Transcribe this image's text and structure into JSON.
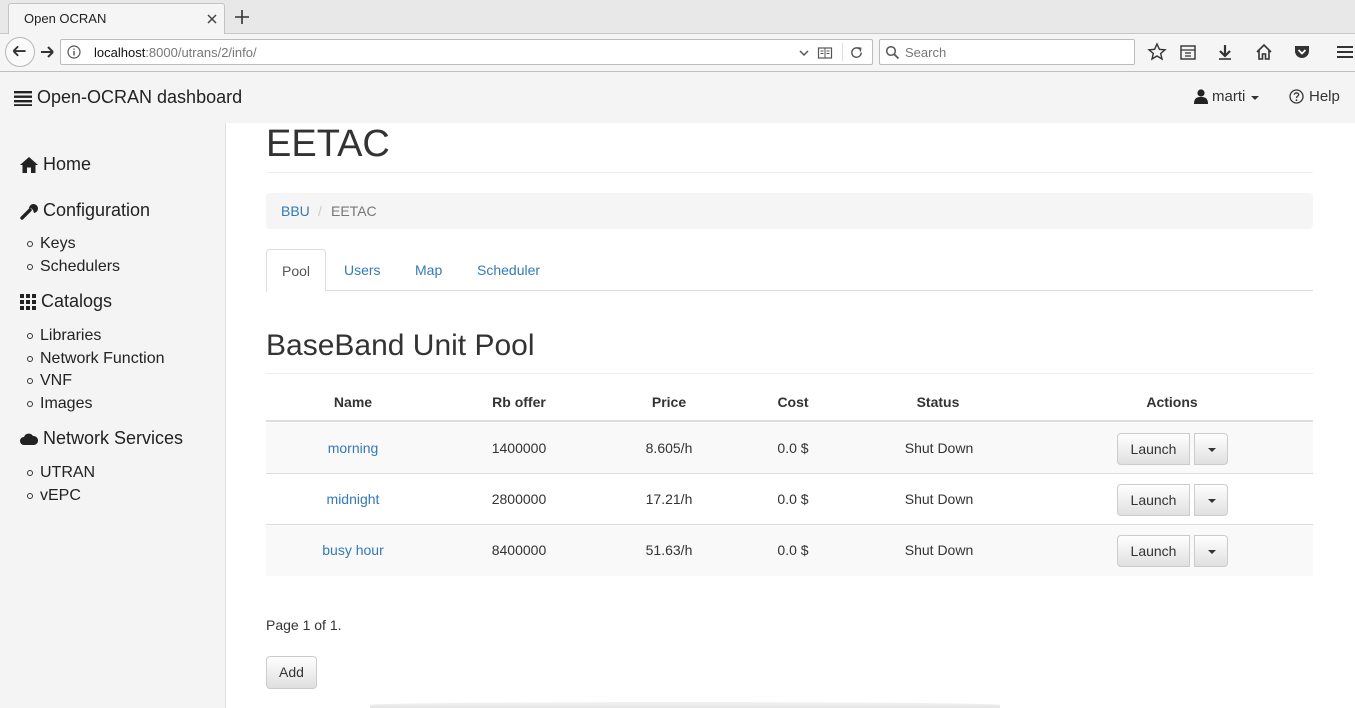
{
  "browser": {
    "tab_title": "Open OCRAN",
    "url_host": "localhost",
    "url_rest": ":8000/utrans/2/info/",
    "search_placeholder": "Search"
  },
  "header": {
    "brand": "Open-OCRAN dashboard",
    "user": "marti",
    "help": "Help"
  },
  "sidebar": {
    "home": "Home",
    "configuration": "Configuration",
    "config_items": [
      "Keys",
      "Schedulers"
    ],
    "catalogs": "Catalogs",
    "catalog_items": [
      "Libraries",
      "Network Function",
      "VNF",
      "Images"
    ],
    "network_services": "Network Services",
    "ns_items": [
      "UTRAN",
      "vEPC"
    ]
  },
  "main": {
    "title": "EETAC",
    "breadcrumb": {
      "link": "BBU",
      "separator": "/",
      "active": "EETAC"
    },
    "tabs": [
      "Pool",
      "Users",
      "Map",
      "Scheduler"
    ],
    "section_title": "BaseBand Unit Pool",
    "table": {
      "headers": [
        "Name",
        "Rb offer",
        "Price",
        "Cost",
        "Status",
        "Actions"
      ],
      "rows": [
        {
          "name": "morning",
          "rb_offer": "1400000",
          "price": "8.605/h",
          "cost": "0.0 $",
          "status": "Shut Down",
          "action": "Launch"
        },
        {
          "name": "midnight",
          "rb_offer": "2800000",
          "price": "17.21/h",
          "cost": "0.0 $",
          "status": "Shut Down",
          "action": "Launch"
        },
        {
          "name": "busy hour",
          "rb_offer": "8400000",
          "price": "51.63/h",
          "cost": "0.0 $",
          "status": "Shut Down",
          "action": "Launch"
        }
      ]
    },
    "pager": "Page 1 of 1.",
    "add_label": "Add"
  },
  "colors": {
    "link": "#337ab7",
    "sidebar_bg": "#f4f4f4"
  }
}
